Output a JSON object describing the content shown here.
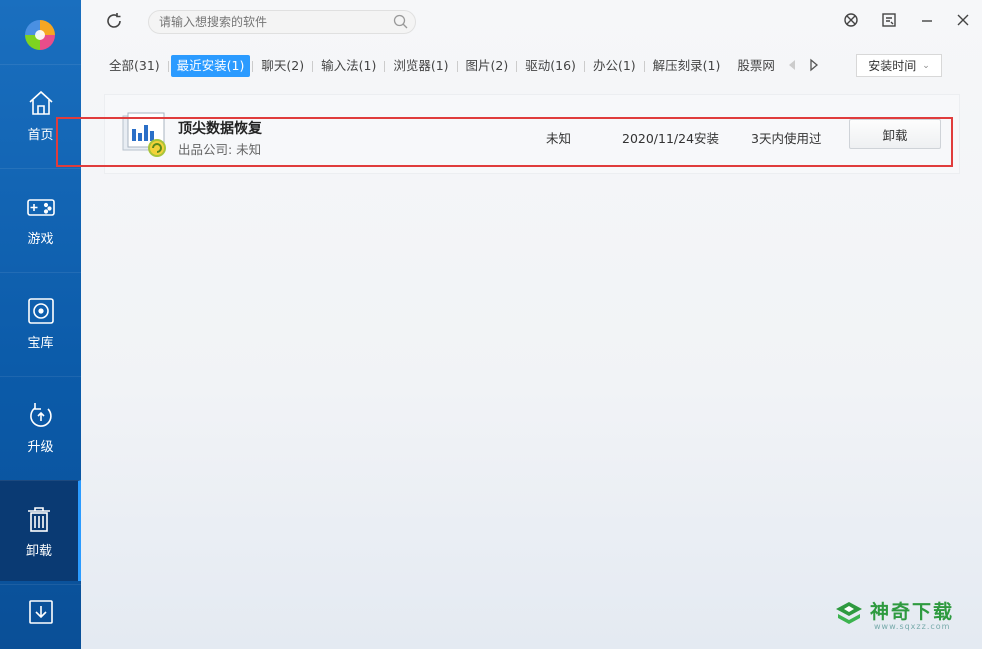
{
  "colors": {
    "sidebar": "#0b5aa8",
    "accent": "#2b9bff",
    "highlight": "#e03c3c",
    "watermark": "#2e9a3f"
  },
  "sidebar": {
    "items": [
      {
        "label": "首页",
        "icon": "home-icon"
      },
      {
        "label": "游戏",
        "icon": "gamepad-icon"
      },
      {
        "label": "宝库",
        "icon": "disc-icon"
      },
      {
        "label": "升级",
        "icon": "upgrade-icon"
      },
      {
        "label": "卸载",
        "icon": "trash-icon",
        "active": true
      },
      {
        "label": "",
        "icon": "download-icon"
      }
    ]
  },
  "search": {
    "placeholder": "请输入想搜索的软件"
  },
  "tabs": [
    {
      "label": "全部(31)"
    },
    {
      "label": "最近安装(1)",
      "active": true
    },
    {
      "label": "聊天(2)"
    },
    {
      "label": "输入法(1)"
    },
    {
      "label": "浏览器(1)"
    },
    {
      "label": "图片(2)"
    },
    {
      "label": "驱动(16)"
    },
    {
      "label": "办公(1)"
    },
    {
      "label": "解压刻录(1)"
    },
    {
      "label": "股票网"
    }
  ],
  "sort": {
    "label": "安装时间"
  },
  "app": {
    "name": "顶尖数据恢复",
    "publisher": "出品公司: 未知",
    "size": "未知",
    "install_date": "2020/11/24安装",
    "usage": "3天内使用过",
    "uninstall_label": "卸载"
  },
  "watermark": {
    "title": "神奇下载",
    "url": "www.sqxzz.com"
  }
}
